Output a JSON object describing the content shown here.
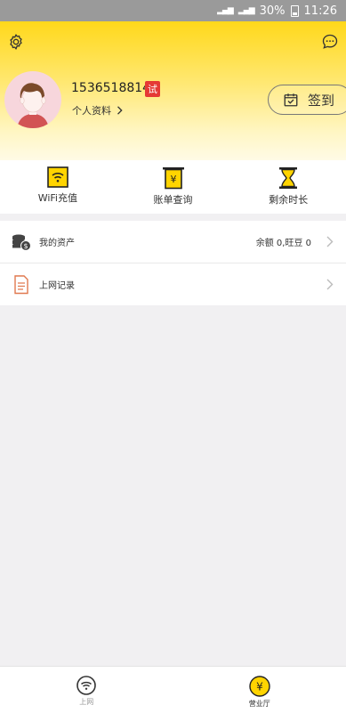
{
  "status_bar": {
    "signal1": "4G",
    "signal2": "4G",
    "battery": "30%",
    "time": "11:26"
  },
  "header": {
    "phone": "15365188143",
    "trial_badge": "试",
    "profile_link": "个人资料",
    "checkin_label": "签到"
  },
  "quick_actions": [
    {
      "label": "WiFi充值"
    },
    {
      "label": "账单查询"
    },
    {
      "label": "剩余时长"
    }
  ],
  "list": [
    {
      "title": "我的资产",
      "value": "余额 0,旺豆 0"
    },
    {
      "title": "上网记录",
      "value": ""
    }
  ],
  "tabs": [
    {
      "label": "上网"
    },
    {
      "label": "营业厅"
    }
  ],
  "colors": {
    "brand_yellow": "#ffd81a",
    "badge_red": "#e53935",
    "active_tab": "#333333",
    "inactive_tab": "#999999"
  }
}
